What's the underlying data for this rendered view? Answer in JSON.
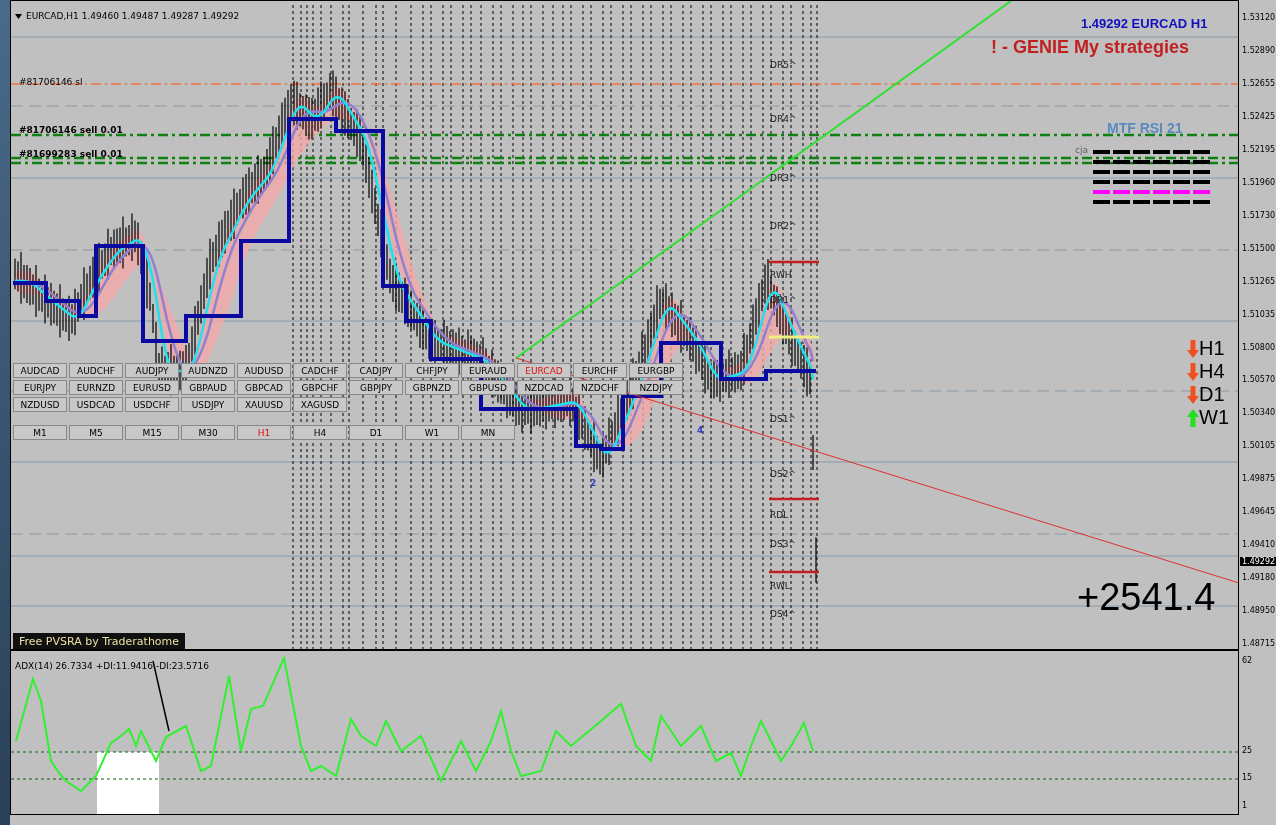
{
  "header": {
    "symbol": "EURCAD,H1",
    "ohlc": "1.49460 1.49487 1.49287 1.49292"
  },
  "price_label": "1.49292 EURCAD H1",
  "strategy_title": "! - GENIE My strategies",
  "order_labels": [
    "#81706146 sl",
    "#81706146 sell 0.01",
    "#81699283 sell 0.01"
  ],
  "rsi_panel": {
    "title": "MTF RSI  21",
    "author": "cja",
    "rows": [
      {
        "color": "#000000"
      },
      {
        "color": "#000000"
      },
      {
        "color": "#000000"
      },
      {
        "color": "#000000"
      },
      {
        "color": "#ff00ff"
      },
      {
        "color": "#000000"
      }
    ]
  },
  "symbol_buttons": [
    {
      "label": "AUDCAD",
      "selected": false
    },
    {
      "label": "AUDCHF",
      "selected": false
    },
    {
      "label": "AUDJPY",
      "selected": false
    },
    {
      "label": "AUDNZD",
      "selected": false
    },
    {
      "label": "AUDUSD",
      "selected": false
    },
    {
      "label": "CADCHF",
      "selected": false
    },
    {
      "label": "CADJPY",
      "selected": false
    },
    {
      "label": "CHFJPY",
      "selected": false
    },
    {
      "label": "EURAUD",
      "selected": false
    },
    {
      "label": "EURCAD",
      "selected": true
    },
    {
      "label": "EURCHF",
      "selected": false
    },
    {
      "label": "EURGBP",
      "selected": false
    },
    {
      "label": "EURJPY",
      "selected": false
    },
    {
      "label": "EURNZD",
      "selected": false
    },
    {
      "label": "EURUSD",
      "selected": false
    },
    {
      "label": "GBPAUD",
      "selected": false
    },
    {
      "label": "GBPCAD",
      "selected": false
    },
    {
      "label": "GBPCHF",
      "selected": false
    },
    {
      "label": "GBPJPY",
      "selected": false
    },
    {
      "label": "GBPNZD",
      "selected": false
    },
    {
      "label": "GBPUSD",
      "selected": false
    },
    {
      "label": "NZDCAD",
      "selected": false
    },
    {
      "label": "NZDCHF",
      "selected": false
    },
    {
      "label": "NZDJPY",
      "selected": false
    },
    {
      "label": "NZDUSD",
      "selected": false
    },
    {
      "label": "USDCAD",
      "selected": false
    },
    {
      "label": "USDCHF",
      "selected": false
    },
    {
      "label": "USDJPY",
      "selected": false
    },
    {
      "label": "XAUUSD",
      "selected": false
    },
    {
      "label": "XAGUSD",
      "selected": false
    }
  ],
  "timeframe_buttons": [
    {
      "label": "M1",
      "selected": false
    },
    {
      "label": "M5",
      "selected": false
    },
    {
      "label": "M15",
      "selected": false
    },
    {
      "label": "M30",
      "selected": false
    },
    {
      "label": "H1",
      "selected": true
    },
    {
      "label": "H4",
      "selected": false
    },
    {
      "label": "D1",
      "selected": false
    },
    {
      "label": "W1",
      "selected": false
    },
    {
      "label": "MN",
      "selected": false
    }
  ],
  "pivot_labels": [
    "DR5^",
    "DR4^",
    "DR3^",
    "DR2^",
    "RWH",
    "DR1^",
    "DS1^",
    "DS2^",
    "RDL",
    "DS3^",
    "RWL",
    "DS4^"
  ],
  "wave_labels": [
    "2",
    "4"
  ],
  "trend_signals": [
    {
      "label": "H1",
      "kind": "down"
    },
    {
      "label": "H4",
      "kind": "down"
    },
    {
      "label": "D1",
      "kind": "down"
    },
    {
      "label": "W1",
      "kind": "up"
    }
  ],
  "profit": "+2541.4",
  "pvsra_label": "Free  PVSRA  by  Traderathome",
  "price_axis": [
    "1.53120",
    "1.52890",
    "1.52655",
    "1.52425",
    "1.52195",
    "1.51960",
    "1.51730",
    "1.51500",
    "1.51265",
    "1.51035",
    "1.50800",
    "1.50570",
    "1.50340",
    "1.50105",
    "1.49875",
    "1.49645",
    "1.49410",
    "1.49180",
    "1.48950",
    "1.48715"
  ],
  "current_price": "1.49292",
  "adx": {
    "label": "ADX(14) 26.7334 +DI:11.9416 -DI:23.5716",
    "axis": [
      "62",
      "25",
      "15",
      "1"
    ]
  }
}
